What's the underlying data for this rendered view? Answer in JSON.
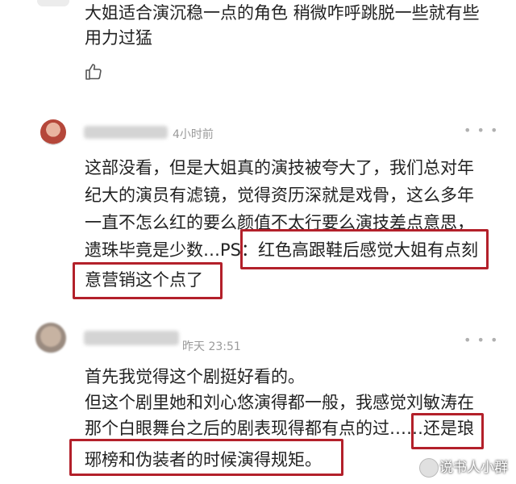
{
  "top_comment": {
    "lines": [
      "大姐适合演沉稳一点的角色 稍微咋呼跳脱一些就有些",
      "用力过猛"
    ],
    "like_icon": "thumbs-up-icon"
  },
  "comment1": {
    "time": "4小时前",
    "lines": [
      "这部没看，但是大姐真的演技被夸大了，我们总对年",
      "纪大的演员有滤镜，觉得资历深就是戏骨，这么多年",
      "一直不怎么红的要么颜值不太行要么演技差点意思，",
      "遗珠毕竟是少数…PS：红色高跟鞋后感觉大姐有点刻",
      "意营销这个点了"
    ],
    "more_icon": "more-dots-icon"
  },
  "comment2": {
    "time": "昨天 23:51",
    "lines": [
      "首先我觉得这个剧挺好看的。",
      "但这个剧里她和刘心悠演得都一般，我感觉刘敏涛在",
      "那个白眼舞台之后的剧表现得都有点的过……还是琅",
      "琊榜和伪装者的时候演得规矩。"
    ],
    "more_icon": "more-dots-icon"
  },
  "watermark": "说书人小群",
  "colors": {
    "highlight": "#b3202a",
    "text": "#222222",
    "meta": "#9a9a9a"
  }
}
